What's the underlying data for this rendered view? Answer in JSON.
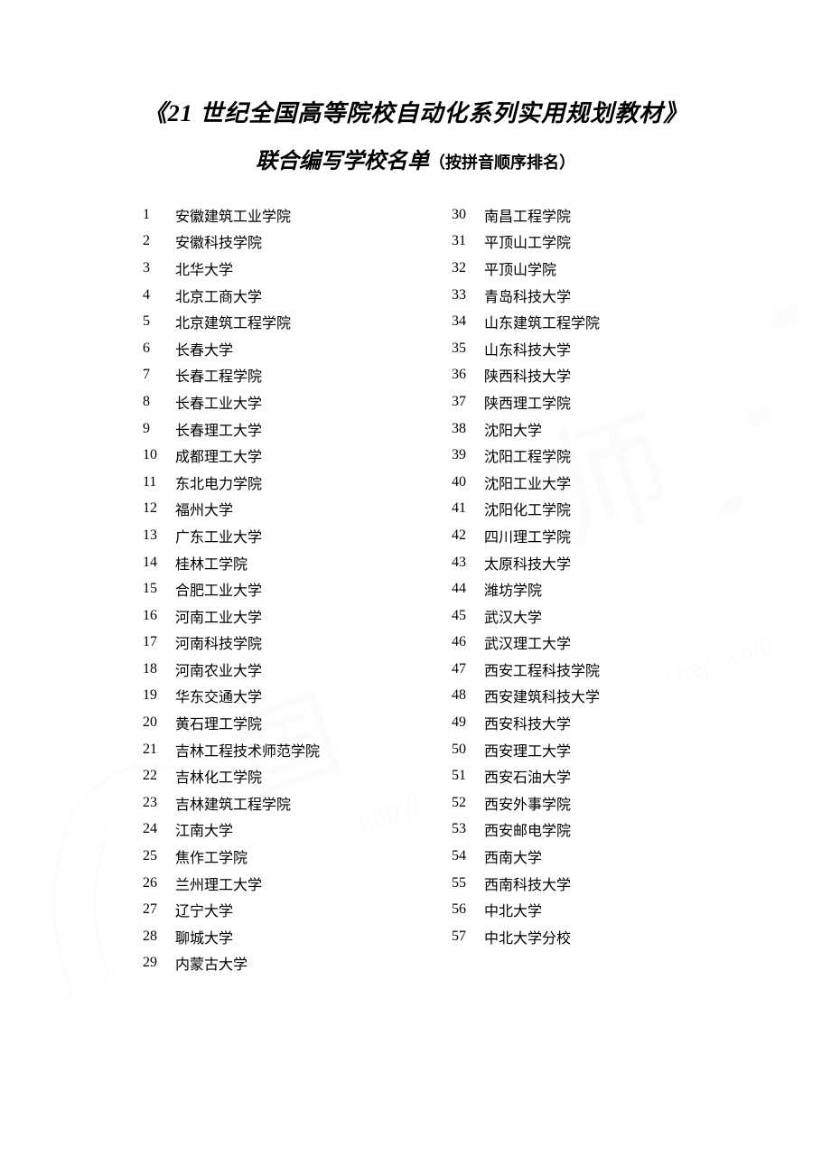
{
  "title": {
    "main": "《21 世纪全国高等院校自动化系列实用规划教材》",
    "sub": "联合编写学校名单",
    "note": "（按拼音顺序排名）"
  },
  "schools": {
    "left": [
      {
        "n": "1",
        "name": "安徽建筑工业学院"
      },
      {
        "n": "2",
        "name": "安徽科技学院"
      },
      {
        "n": "3",
        "name": "北华大学"
      },
      {
        "n": "4",
        "name": "北京工商大学"
      },
      {
        "n": "5",
        "name": "北京建筑工程学院"
      },
      {
        "n": "6",
        "name": "长春大学"
      },
      {
        "n": "7",
        "name": "长春工程学院"
      },
      {
        "n": "8",
        "name": "长春工业大学"
      },
      {
        "n": "9",
        "name": "长春理工大学"
      },
      {
        "n": "10",
        "name": "成都理工大学"
      },
      {
        "n": "11",
        "name": "东北电力学院"
      },
      {
        "n": "12",
        "name": "福州大学"
      },
      {
        "n": "13",
        "name": "广东工业大学"
      },
      {
        "n": "14",
        "name": "桂林工学院"
      },
      {
        "n": "15",
        "name": "合肥工业大学"
      },
      {
        "n": "16",
        "name": "河南工业大学"
      },
      {
        "n": "17",
        "name": "河南科技学院"
      },
      {
        "n": "18",
        "name": "河南农业大学"
      },
      {
        "n": "19",
        "name": "华东交通大学"
      },
      {
        "n": "20",
        "name": "黄石理工学院"
      },
      {
        "n": "21",
        "name": "吉林工程技术师范学院"
      },
      {
        "n": "22",
        "name": "吉林化工学院"
      },
      {
        "n": "23",
        "name": "吉林建筑工程学院"
      },
      {
        "n": "24",
        "name": "江南大学"
      },
      {
        "n": "25",
        "name": "焦作工学院"
      },
      {
        "n": "26",
        "name": "兰州理工大学"
      },
      {
        "n": "27",
        "name": "辽宁大学"
      },
      {
        "n": "28",
        "name": "聊城大学"
      },
      {
        "n": "29",
        "name": "内蒙古大学"
      }
    ],
    "right": [
      {
        "n": "30",
        "name": "南昌工程学院"
      },
      {
        "n": "31",
        "name": "平顶山工学院"
      },
      {
        "n": "32",
        "name": "平顶山学院"
      },
      {
        "n": "33",
        "name": "青岛科技大学"
      },
      {
        "n": "34",
        "name": "山东建筑工程学院"
      },
      {
        "n": "35",
        "name": "山东科技大学"
      },
      {
        "n": "36",
        "name": "陕西科技大学"
      },
      {
        "n": "37",
        "name": "陕西理工学院"
      },
      {
        "n": "38",
        "name": "沈阳大学"
      },
      {
        "n": "39",
        "name": "沈阳工程学院"
      },
      {
        "n": "40",
        "name": "沈阳工业大学"
      },
      {
        "n": "41",
        "name": "沈阳化工学院"
      },
      {
        "n": "42",
        "name": "四川理工学院"
      },
      {
        "n": "43",
        "name": "太原科技大学"
      },
      {
        "n": "44",
        "name": "潍坊学院"
      },
      {
        "n": "45",
        "name": "武汉大学"
      },
      {
        "n": "46",
        "name": "武汉理工大学"
      },
      {
        "n": "47",
        "name": "西安工程科技学院"
      },
      {
        "n": "48",
        "name": "西安建筑科技大学"
      },
      {
        "n": "49",
        "name": "西安科技大学"
      },
      {
        "n": "50",
        "name": "西安理工大学"
      },
      {
        "n": "51",
        "name": "西安石油大学"
      },
      {
        "n": "52",
        "name": "西安外事学院"
      },
      {
        "n": "53",
        "name": "西安邮电学院"
      },
      {
        "n": "54",
        "name": "西南大学"
      },
      {
        "n": "55",
        "name": "西南科技大学"
      },
      {
        "n": "56",
        "name": "中北大学"
      },
      {
        "n": "57",
        "name": "中北大学分校"
      }
    ]
  }
}
